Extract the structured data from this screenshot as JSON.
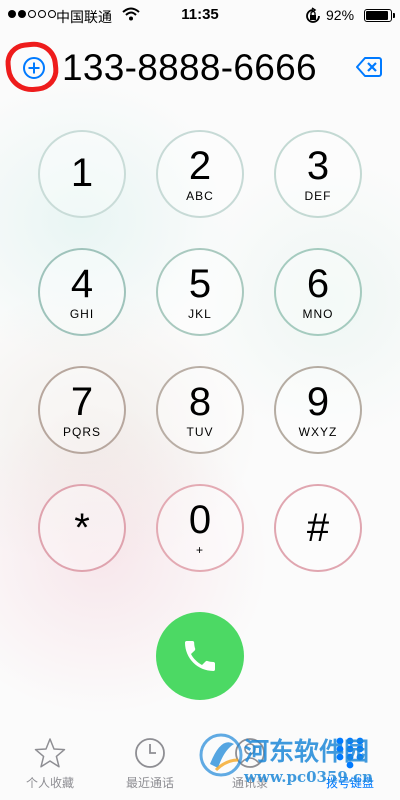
{
  "status_bar": {
    "carrier": "中国联通",
    "time": "11:35",
    "battery": "92%",
    "battery_level": 0.92,
    "signal_bars": 2
  },
  "dialer": {
    "number": "133-8888-6666",
    "add_contact_icon": "plus-circle-icon",
    "delete_icon": "backspace-icon"
  },
  "keys": [
    {
      "digit": "1",
      "letters": ""
    },
    {
      "digit": "2",
      "letters": "ABC"
    },
    {
      "digit": "3",
      "letters": "DEF"
    },
    {
      "digit": "4",
      "letters": "GHI"
    },
    {
      "digit": "5",
      "letters": "JKL"
    },
    {
      "digit": "6",
      "letters": "MNO"
    },
    {
      "digit": "7",
      "letters": "PQRS"
    },
    {
      "digit": "8",
      "letters": "TUV"
    },
    {
      "digit": "9",
      "letters": "WXYZ"
    },
    {
      "digit": "*",
      "letters": ""
    },
    {
      "digit": "0",
      "letters": "+"
    },
    {
      "digit": "#",
      "letters": ""
    }
  ],
  "call_button": {
    "icon": "phone-icon",
    "color": "#4cd964"
  },
  "tabs": [
    {
      "label": "个人收藏",
      "icon": "star-icon"
    },
    {
      "label": "最近通话",
      "icon": "clock-icon"
    },
    {
      "label": "通讯录",
      "icon": "contacts-icon"
    },
    {
      "label": "拨号键盘",
      "icon": "keypad-icon",
      "active": true
    }
  ],
  "watermark": {
    "title": "河东软件园",
    "url": "www.pc0359.cn"
  },
  "colors": {
    "accent": "#007aff",
    "call_green": "#4cd964",
    "highlight_red": "#ee1c1c",
    "inactive_gray": "#8e8e93"
  }
}
